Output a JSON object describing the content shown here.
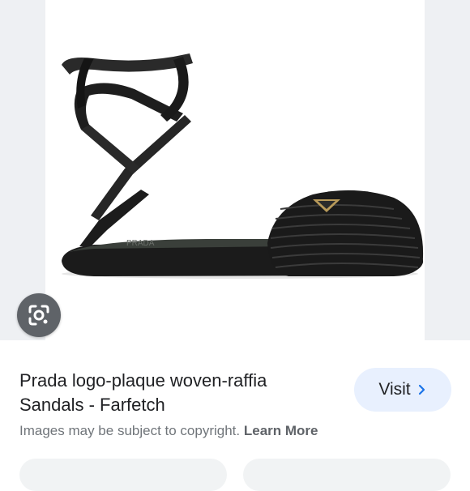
{
  "result": {
    "title_line1": "Prada logo-plaque woven-raffia",
    "title_line2": "Sandals - Farfetch",
    "visit_label": "Visit",
    "copyright_text": "Images may be subject to copyright.",
    "learn_more": "Learn More"
  },
  "image": {
    "logo_text": "PRADA"
  },
  "icons": {
    "lens": "camera-lens-icon",
    "visit_arrow": "chevron-right-icon"
  },
  "colors": {
    "accent_blue": "#1a73e8",
    "visit_bg": "#e8f0fe",
    "lens_bg": "#5f6368",
    "side_bg": "#eef0f3",
    "text_primary": "#202124",
    "text_secondary": "#70757a"
  }
}
